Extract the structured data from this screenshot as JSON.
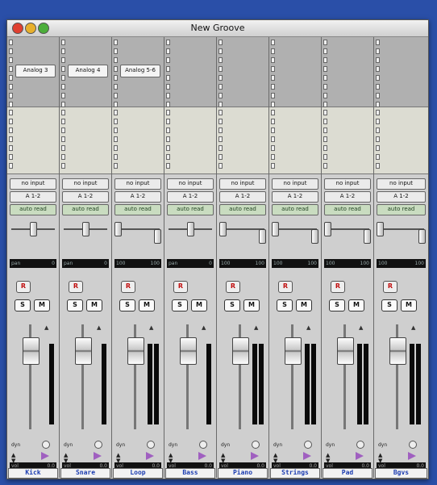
{
  "window": {
    "title": "New Groove"
  },
  "channels": [
    {
      "name": "Kick",
      "insert": "Analog 3",
      "input": "no input",
      "output": "A 1-2",
      "automation": "auto read",
      "pan": [
        "pan",
        "0"
      ],
      "volume": [
        "vol",
        "0.0"
      ],
      "stereo": false
    },
    {
      "name": "Snare",
      "insert": "Analog 4",
      "input": "no input",
      "output": "A 1-2",
      "automation": "auto read",
      "pan": [
        "pan",
        "0"
      ],
      "volume": [
        "vol",
        "0.0"
      ],
      "stereo": false
    },
    {
      "name": "Loop",
      "insert": "Analog 5-6",
      "input": "no input",
      "output": "A 1-2",
      "automation": "auto read",
      "pan": [
        "100",
        "100"
      ],
      "volume": [
        "vol",
        "0.0"
      ],
      "stereo": true
    },
    {
      "name": "Bass",
      "insert": "",
      "input": "no input",
      "output": "A 1-2",
      "automation": "auto read",
      "pan": [
        "pan",
        "0"
      ],
      "volume": [
        "vol",
        "0.0"
      ],
      "stereo": false
    },
    {
      "name": "Piano",
      "insert": "",
      "input": "no input",
      "output": "A 1-2",
      "automation": "auto read",
      "pan": [
        "100",
        "100"
      ],
      "volume": [
        "vol",
        "0.0"
      ],
      "stereo": true
    },
    {
      "name": "Strings",
      "insert": "",
      "input": "no input",
      "output": "A 1-2",
      "automation": "auto read",
      "pan": [
        "100",
        "100"
      ],
      "volume": [
        "vol",
        "0.0"
      ],
      "stereo": true
    },
    {
      "name": "Pad",
      "insert": "",
      "input": "no input",
      "output": "A 1-2",
      "automation": "auto read",
      "pan": [
        "100",
        "100"
      ],
      "volume": [
        "vol",
        "0.0"
      ],
      "stereo": true
    },
    {
      "name": "Bgvs",
      "insert": "",
      "input": "no input",
      "output": "A 1-2",
      "automation": "auto read",
      "pan": [
        "100",
        "100"
      ],
      "volume": [
        "vol",
        "0.0"
      ],
      "stereo": true
    }
  ],
  "buttons": {
    "record": "R",
    "solo": "S",
    "mute": "M",
    "dyn": "dyn"
  }
}
